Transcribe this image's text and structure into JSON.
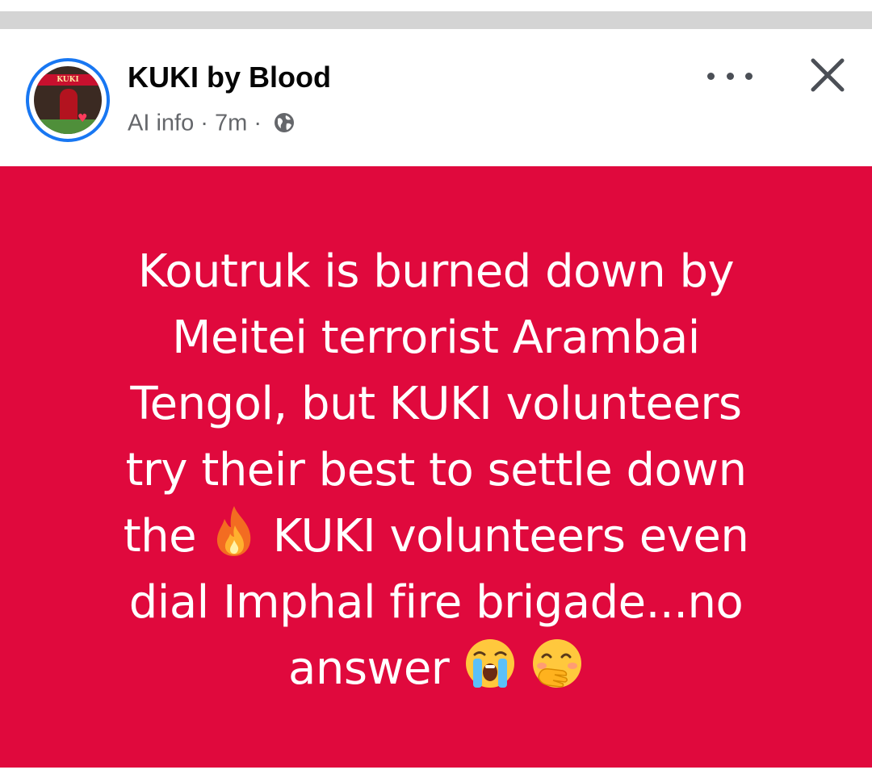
{
  "post": {
    "page_name": "KUKI by Blood",
    "avatar_banner_text": "KUKI",
    "meta_label": "AI info",
    "time_ago": "7m",
    "separator": "·",
    "audience_icon": "globe-icon",
    "more_icon": "more-horizontal-icon",
    "close_icon": "close-icon",
    "background_color": "#e0093d",
    "text_lines": [
      "Koutruk is burned down by",
      "Meitei terrorist Arambai",
      "Tengol, but KUKI volunteers",
      "try their best to settle down",
      "the",
      "KUKI volunteers even",
      "dial Imphal fire brigade...no",
      "answer"
    ],
    "emojis": [
      "fire-emoji",
      "loudly-crying-face-emoji",
      "face-with-hand-over-mouth-emoji"
    ]
  }
}
